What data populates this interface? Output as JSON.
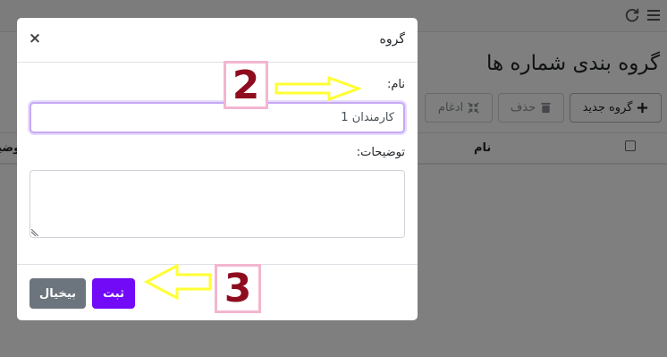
{
  "app": {
    "page_title": "گروه بندی شماره ها"
  },
  "toolbar": {
    "new_group_label": "گروه جدید",
    "delete_label": "حذف",
    "merge_label": "ادغام"
  },
  "table": {
    "headers": {
      "name": "نام",
      "description": "توضیحات"
    }
  },
  "modal": {
    "title": "گروه",
    "close_symbol": "×",
    "name_label": "نام:",
    "name_value": "کارمندان 1",
    "description_label": "توضیحات:",
    "description_value": "",
    "submit_label": "ثبت",
    "cancel_label": "بیخیال"
  },
  "annotations": {
    "step_2": "2",
    "step_3": "3",
    "arrow_color": "#ffff33"
  },
  "colors": {
    "primary": "#7209f7",
    "secondary": "#6c757d",
    "step_text": "#8e0c1e",
    "step_border": "#f2b6cf"
  },
  "icons": {
    "menu": "hamburger-menu-icon",
    "refresh": "refresh-icon",
    "plus": "plus-icon",
    "trash": "trash-icon",
    "merge": "compress-arrows-icon"
  }
}
